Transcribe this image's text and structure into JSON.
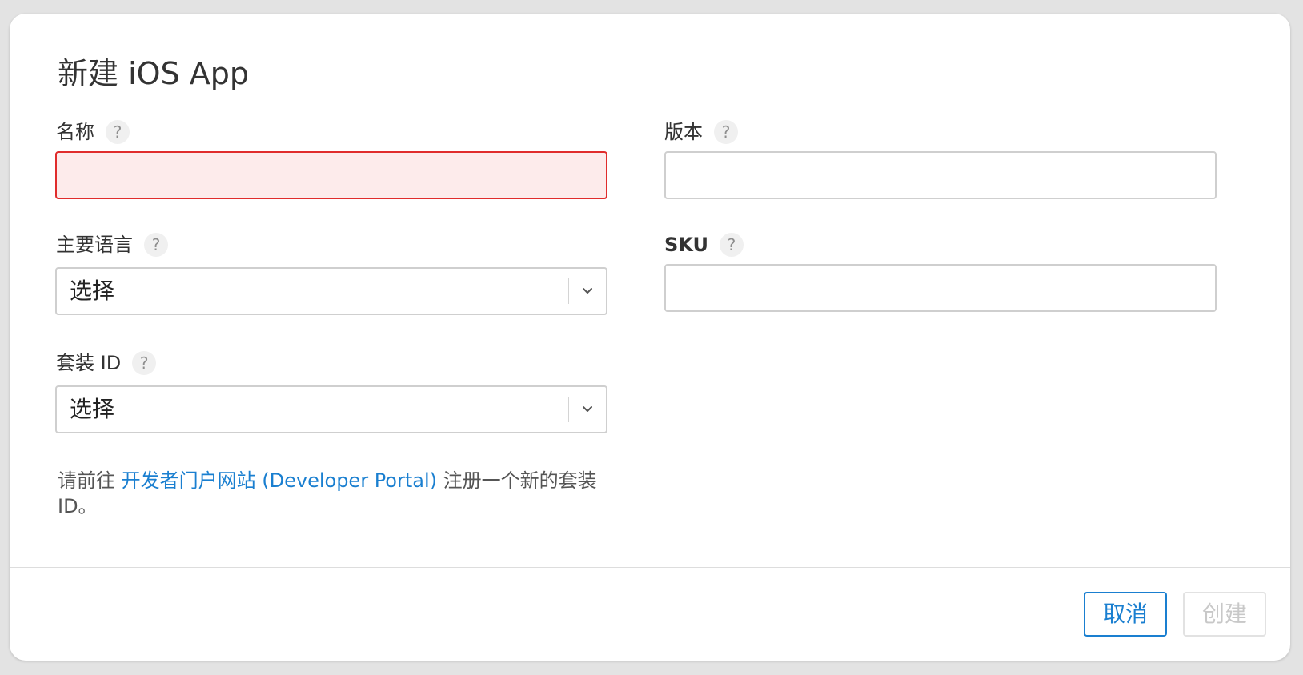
{
  "dialog": {
    "title": "新建 iOS App"
  },
  "form": {
    "name": {
      "label": "名称",
      "value": "",
      "placeholder": ""
    },
    "version": {
      "label": "版本",
      "value": "",
      "placeholder": ""
    },
    "primary_language": {
      "label": "主要语言",
      "selected": "选择"
    },
    "sku": {
      "label": "SKU",
      "value": "",
      "placeholder": ""
    },
    "bundle_id": {
      "label": "套装 ID",
      "selected": "选择"
    },
    "help_glyph": "?"
  },
  "hint": {
    "prefix": "请前往 ",
    "link_text": "开发者门户网站 (Developer Portal)",
    "suffix": " 注册一个新的套装 ID。"
  },
  "footer": {
    "cancel_label": "取消",
    "create_label": "创建"
  },
  "colors": {
    "accent": "#1a7fd0",
    "error_border": "#e02c2c",
    "error_fill": "#fdebeb"
  },
  "icons": {
    "help": "question-circle-icon",
    "dropdown": "chevron-down-icon"
  }
}
